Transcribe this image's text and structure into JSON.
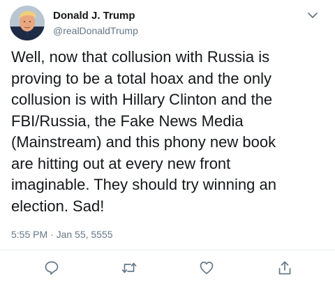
{
  "tweet": {
    "display_name": "Donald J. Trump",
    "handle": "@realDonaldTrump",
    "text_lines": [
      "Well, now that collusion with Russia is",
      "proving to be a total hoax and the only",
      "collusion is with Hillary Clinton and the",
      "FBI/Russia, the Fake News Media",
      "(Mainstream) and this phony new book",
      "are hitting out at every new front",
      "imaginable. They should try winning an",
      "election. Sad!"
    ],
    "timestamp": "5:55 PM · Jan 55, 5555"
  },
  "icons": {
    "menu": "chevron-down-icon",
    "reply": "reply-icon",
    "retweet": "retweet-icon",
    "like": "heart-icon",
    "share": "share-icon"
  },
  "colors": {
    "text": "#14171a",
    "secondary_text": "#657786",
    "icon": "#657786",
    "divider": "#e6ecf0",
    "background": "#ffffff"
  }
}
